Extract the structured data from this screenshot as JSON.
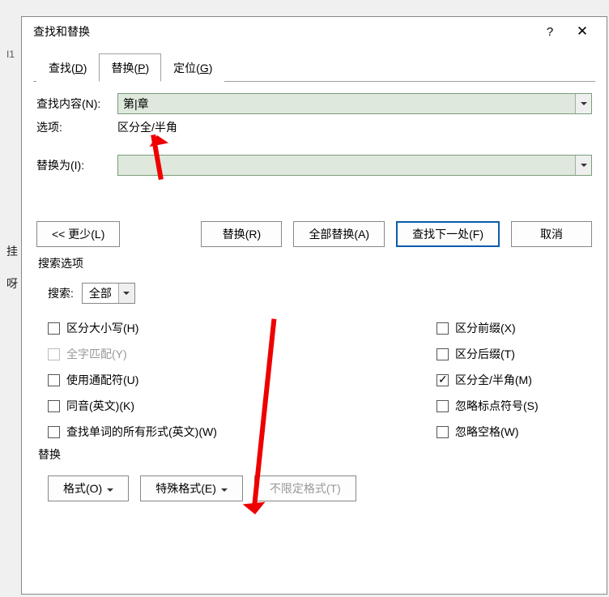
{
  "left_strip": {
    "i1": "I1",
    "gua": "挂",
    "ya": "呀"
  },
  "dialog": {
    "title": "查找和替换",
    "help_label": "?",
    "close_label": "✕",
    "tabs": {
      "find": {
        "pre": "查找(",
        "key": "D",
        "post": ")"
      },
      "replace": {
        "pre": "替换(",
        "key": "P",
        "post": ")"
      },
      "goto": {
        "pre": "定位(",
        "key": "G",
        "post": ")"
      }
    },
    "find_label": "查找内容(N):",
    "find_value": "第|章",
    "options_label": "选项:",
    "options_value": "区分全/半角",
    "replace_label": "替换为(I):",
    "replace_value": "",
    "buttons": {
      "less": "<< 更少(L)",
      "replace": "替换(R)",
      "replace_all": "全部替换(A)",
      "find_next": "查找下一处(F)",
      "cancel": "取消"
    },
    "search_options": {
      "legend": "搜索选项",
      "search_label": "搜索:",
      "search_value": "全部",
      "left": [
        {
          "id": "match_case",
          "label": "区分大小写(H)",
          "checked": false,
          "disabled": false
        },
        {
          "id": "whole_word",
          "label": "全字匹配(Y)",
          "checked": false,
          "disabled": true
        },
        {
          "id": "wildcards",
          "label": "使用通配符(U)",
          "checked": false,
          "disabled": false
        },
        {
          "id": "sounds_like",
          "label": "同音(英文)(K)",
          "checked": false,
          "disabled": false
        },
        {
          "id": "word_forms",
          "label": "查找单词的所有形式(英文)(W)",
          "checked": false,
          "disabled": false
        }
      ],
      "right": [
        {
          "id": "prefix",
          "label": "区分前缀(X)",
          "checked": false
        },
        {
          "id": "suffix",
          "label": "区分后缀(T)",
          "checked": false
        },
        {
          "id": "full_half",
          "label": "区分全/半角(M)",
          "checked": true
        },
        {
          "id": "ignore_punct",
          "label": "忽略标点符号(S)",
          "checked": false
        },
        {
          "id": "ignore_space",
          "label": "忽略空格(W)",
          "checked": false
        }
      ]
    },
    "bottom": {
      "legend": "替换",
      "format": "格式(O)",
      "special": "特殊格式(E)",
      "no_format": "不限定格式(T)"
    }
  }
}
